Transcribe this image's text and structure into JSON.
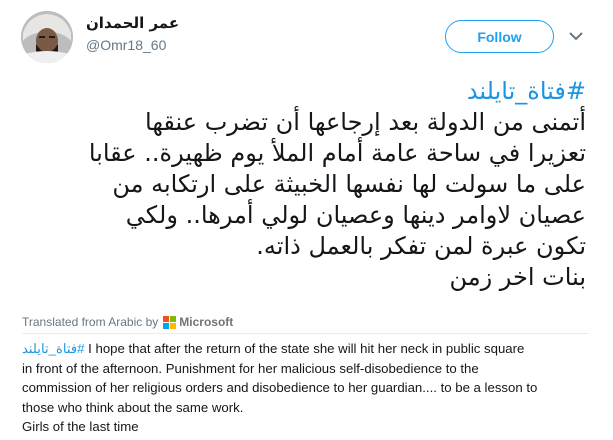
{
  "user": {
    "display_name": "عمر الحمدان",
    "handle": "@Omr18_60"
  },
  "follow_label": "Follow",
  "tweet": {
    "hashtag": "#فتاة_تايلند",
    "lines": [
      "أتمنى من الدولة بعد إرجاعها أن تضرب عنقها",
      "تعزيرا في ساحة عامة أمام الملأ يوم ظهيرة.. عقابا",
      "على ما سولت لها نفسها الخبيثة على ارتكابه من",
      "عصيان لاوامر دينها وعصيان لولي أمرها.. ولكي",
      "تكون عبرة لمن تفكر بالعمل ذاته.",
      "بنات اخر زمن"
    ]
  },
  "translation": {
    "label": "Translated from Arabic by",
    "provider": "Microsoft",
    "hashtag": "#فتاة_تايلند",
    "first_line_rest": " I hope that after the return of the state she will hit her neck in public square",
    "lines": [
      "in front of the afternoon. Punishment for her malicious self-disobedience to the",
      "commission of her religious orders and disobedience to her guardian.... to be a lesson to",
      "those who think about the same work.",
      "Girls of the last time"
    ]
  },
  "colors": {
    "link": "#1b95e0",
    "follow": "#1da1f2",
    "muted": "#657786"
  },
  "icons": {
    "menu": "chevron-down-icon",
    "microsoft": "microsoft-logo"
  }
}
